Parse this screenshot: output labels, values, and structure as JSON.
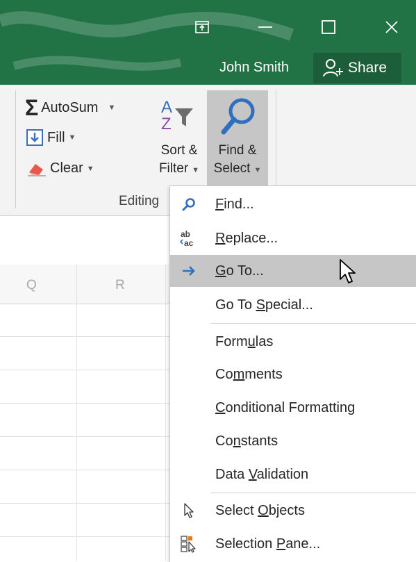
{
  "window": {
    "user_name": "John Smith",
    "share_label": "Share",
    "icons": [
      "ribbon-display-icon",
      "minimize-icon",
      "maximize-icon",
      "close-icon"
    ]
  },
  "ribbon": {
    "autosum_label": "AutoSum",
    "fill_label": "Fill",
    "clear_label": "Clear",
    "sort_filter_line1": "Sort &",
    "sort_filter_line2": "Filter",
    "find_select_line1": "Find &",
    "find_select_line2": "Select",
    "group_label": "Editing"
  },
  "sheet": {
    "columns": [
      "Q",
      "R"
    ]
  },
  "menu": {
    "items": [
      {
        "pre": "",
        "key": "F",
        "post": "ind...",
        "icon": "search-icon"
      },
      {
        "pre": "",
        "key": "R",
        "post": "eplace...",
        "icon": "replace-icon"
      },
      {
        "pre": "",
        "key": "G",
        "post": "o To...",
        "icon": "arrow-right-icon",
        "highlighted": true
      },
      {
        "pre": "Go To ",
        "key": "S",
        "post": "pecial...",
        "icon": ""
      },
      {
        "pre": "Form",
        "key": "u",
        "post": "las",
        "icon": ""
      },
      {
        "pre": "Co",
        "key": "m",
        "post": "ments",
        "icon": ""
      },
      {
        "pre": "",
        "key": "C",
        "post": "onditional Formatting",
        "icon": ""
      },
      {
        "pre": "Co",
        "key": "n",
        "post": "stants",
        "icon": ""
      },
      {
        "pre": "Data ",
        "key": "V",
        "post": "alidation",
        "icon": ""
      },
      {
        "pre": "Select ",
        "key": "O",
        "post": "bjects",
        "icon": "select-objects-icon"
      },
      {
        "pre": "Selection ",
        "key": "P",
        "post": "ane...",
        "icon": "selection-pane-icon"
      }
    ]
  }
}
